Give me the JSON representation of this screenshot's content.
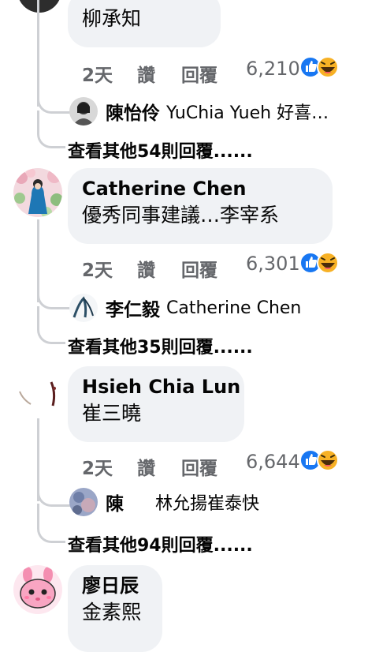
{
  "comments": [
    {
      "author": "",
      "text": "柳承知",
      "time": "2天",
      "like_label": "讚",
      "reply_label": "回覆",
      "reaction_count": "6,210",
      "reactions": [
        "like-icon",
        "haha-icon"
      ],
      "reply_preview": {
        "author": "陳怡伶",
        "text": "YuChia Yueh 好喜…"
      },
      "more_replies": "查看其他54則回覆......"
    },
    {
      "author": "Catherine Chen",
      "text": "優秀同事建議…李宰系",
      "time": "2天",
      "like_label": "讚",
      "reply_label": "回覆",
      "reaction_count": "6,301",
      "reactions": [
        "like-icon",
        "haha-icon"
      ],
      "reply_preview": {
        "author": "李仁毅",
        "text": "Catherine Chen"
      },
      "more_replies": "查看其他35則回覆......"
    },
    {
      "author": "Hsieh Chia Lun",
      "text": "崔三曉",
      "time": "2天",
      "like_label": "讚",
      "reply_label": "回覆",
      "reaction_count": "6,644",
      "reactions": [
        "like-icon",
        "haha-icon"
      ],
      "reply_preview": {
        "author": "陳",
        "text": "林允揚崔泰快"
      },
      "more_replies": "查看其他94則回覆......"
    },
    {
      "author": "廖日辰",
      "text": "金素熙"
    }
  ],
  "colors": {
    "bubble_bg": "#f0f2f5",
    "meta_text": "#65676b",
    "thread_line": "#ced0d4",
    "like_blue": "#1877f2",
    "haha_yellow": "#f7b125"
  }
}
